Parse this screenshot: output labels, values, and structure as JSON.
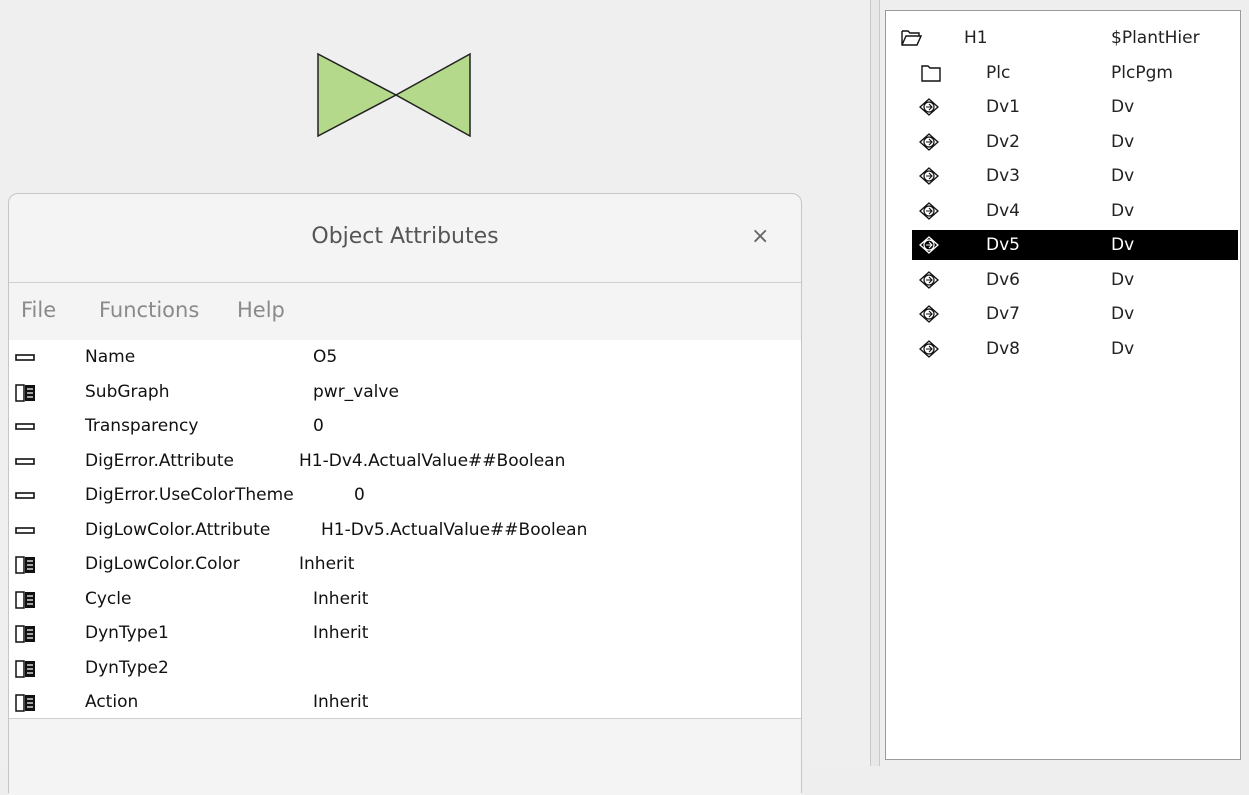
{
  "colors": {
    "valve_fill": "#b5d98a",
    "selection": "#000000"
  },
  "tree": {
    "rows": [
      {
        "icon": "open-folder-icon",
        "name": "H1",
        "class": "$PlantHier"
      },
      {
        "icon": "folder-icon",
        "name": "Plc",
        "class": "PlcPgm"
      },
      {
        "icon": "leaf-object-icon",
        "name": "Dv1",
        "class": "Dv"
      },
      {
        "icon": "leaf-object-icon",
        "name": "Dv2",
        "class": "Dv"
      },
      {
        "icon": "leaf-object-icon",
        "name": "Dv3",
        "class": "Dv"
      },
      {
        "icon": "leaf-object-icon",
        "name": "Dv4",
        "class": "Dv"
      },
      {
        "icon": "leaf-object-icon",
        "name": "Dv5",
        "class": "Dv",
        "selected": true
      },
      {
        "icon": "leaf-object-icon",
        "name": "Dv6",
        "class": "Dv"
      },
      {
        "icon": "leaf-object-icon",
        "name": "Dv7",
        "class": "Dv"
      },
      {
        "icon": "leaf-object-icon",
        "name": "Dv8",
        "class": "Dv"
      }
    ]
  },
  "dialog": {
    "title": "Object Attributes",
    "close_label": "×",
    "menu": {
      "file": "File",
      "functions": "Functions",
      "help": "Help"
    },
    "attributes": [
      {
        "icon": "attribute-icon",
        "name": "Name",
        "value": "O5"
      },
      {
        "icon": "object-icon",
        "name": "SubGraph",
        "value": "pwr_valve"
      },
      {
        "icon": "attribute-icon",
        "name": "Transparency",
        "value": "0"
      },
      {
        "icon": "attribute-icon",
        "name": "DigError.Attribute",
        "value": "H1-Dv4.ActualValue##Boolean"
      },
      {
        "icon": "attribute-icon",
        "name": "DigError.UseColorTheme",
        "value": "0"
      },
      {
        "icon": "attribute-icon",
        "name": "DigLowColor.Attribute",
        "value": "H1-Dv5.ActualValue##Boolean"
      },
      {
        "icon": "object-icon",
        "name": "DigLowColor.Color",
        "value": "Inherit"
      },
      {
        "icon": "object-icon",
        "name": "Cycle",
        "value": "Inherit"
      },
      {
        "icon": "object-icon",
        "name": "DynType1",
        "value": "Inherit"
      },
      {
        "icon": "object-icon",
        "name": "DynType2",
        "value": ""
      },
      {
        "icon": "object-icon",
        "name": "Action",
        "value": "Inherit"
      }
    ]
  }
}
